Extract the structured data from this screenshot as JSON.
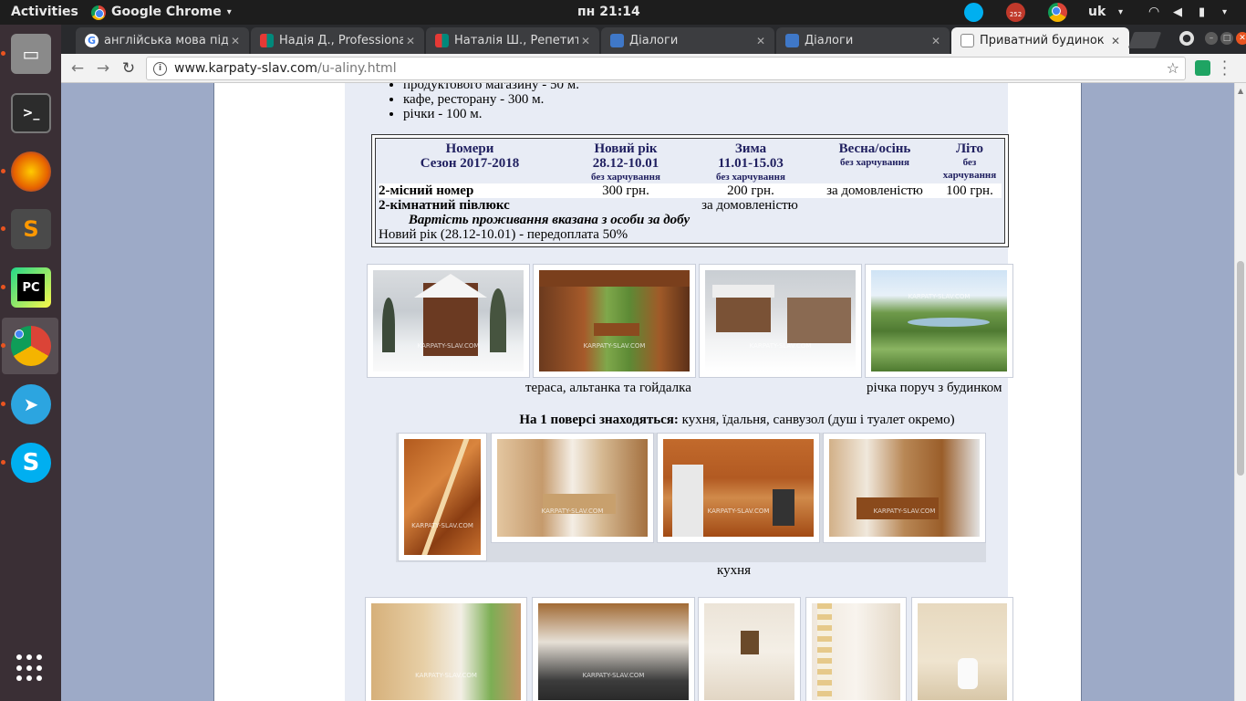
{
  "topbar": {
    "activities": "Activities",
    "app_name": "Google Chrome",
    "app_caret": "▾",
    "clock": "пн 21:14",
    "badge": "252",
    "language": "uk",
    "lang_caret": "▾"
  },
  "browser": {
    "tabs": [
      {
        "label": "англійська мова піді",
        "favicon": "google-g-icon"
      },
      {
        "label": "Надія Д., Professiona",
        "favicon": "tutor-site-icon"
      },
      {
        "label": "Наталія Ш., Репетит",
        "favicon": "tutor-site-icon"
      },
      {
        "label": "Діалоги",
        "favicon": "dialog-chat-icon"
      },
      {
        "label": "Діалоги",
        "favicon": "dialog-chat-icon"
      },
      {
        "label": "Приватний будинок",
        "favicon": "page-document-icon"
      }
    ],
    "url_host": "www.karpaty-slav.com",
    "url_path": "/u-aliny.html"
  },
  "page": {
    "distances": [
      "продуктового магазину - 50 м.",
      "кафе, ресторану - 300 м.",
      "річки - 100 м."
    ],
    "price_table": {
      "col_rooms": "Номери",
      "season": "Сезон 2017-2018",
      "col_newyear": "Новий рік",
      "newyear_dates": "28.12-10.01",
      "newyear_note": "без харчування",
      "col_winter": "Зима",
      "winter_dates": "11.01-15.03",
      "winter_note": "без харчування",
      "col_spring": "Весна/осінь",
      "spring_note": "без харчування",
      "col_summer": "Літо",
      "summer_note": "без харчування",
      "rows": [
        {
          "name": "2-місний номер",
          "newyear": "300 грн.",
          "winter": "200 грн.",
          "spring": "за домовленістю",
          "summer": "100 грн."
        },
        {
          "name": "2-кімнатний півлюкс",
          "all": "за домовленістю"
        }
      ],
      "price_note": "Вартість проживання вказана з особи за добу",
      "prepay_note": "Новий рік (28.12-10.01) - передоплата 50%"
    },
    "gallery1_caption_left": "тераса, альтанка та гойдалка",
    "gallery1_caption_right": "річка поруч з будинком",
    "floor1_label": "На 1 поверсі знаходяться:",
    "floor1_text": " кухня, їдальня, санвузол (душ і туалет окремо)",
    "gallery2_caption": "кухня",
    "watermark": "KARPATY-SLAV.COM"
  }
}
